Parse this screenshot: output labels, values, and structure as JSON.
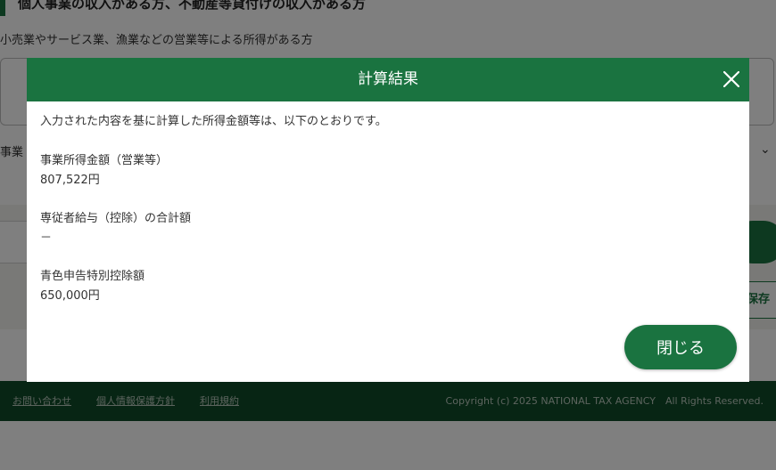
{
  "background": {
    "section_heading": "個人事業の収入がある方、不動産等貸付けの収入がある方",
    "section_description": "小売業やサービス業、漁業などの営業等による所得がある方",
    "select_label": "事業",
    "save_button_label": "保存"
  },
  "footer": {
    "links": [
      "お問い合わせ",
      "個人情報保護方針",
      "利用規約"
    ],
    "copyright": "Copyright (c) 2025 NATIONAL TAX AGENCY　All Rights Reserved."
  },
  "modal": {
    "title": "計算結果",
    "intro": "入力された内容を基に計算した所得金額等は、以下のとおりです。",
    "results": [
      {
        "label": "事業所得金額（営業等）",
        "value": "807,522円"
      },
      {
        "label": "専従者給与（控除）の合計額",
        "value": "－"
      },
      {
        "label": "青色申告特別控除額",
        "value": "650,000円"
      }
    ],
    "close_button_label": "閉じる"
  },
  "colors": {
    "brand_green": "#1a7340",
    "footer_green": "#0f4a28"
  },
  "icons": {
    "close": "close-icon",
    "chevron": "chevron-down-icon"
  }
}
